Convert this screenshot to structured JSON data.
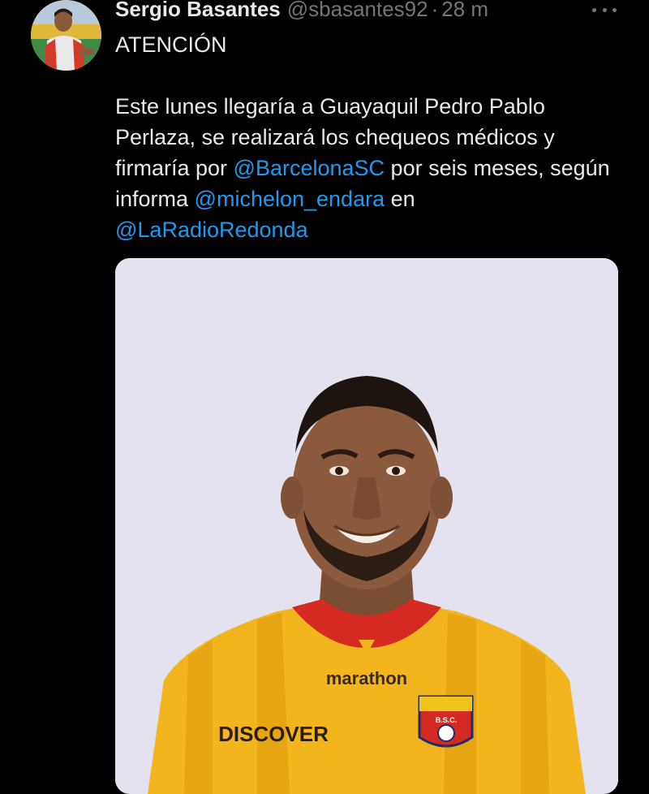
{
  "author": {
    "display_name": "Sergio Basantes",
    "handle": "@sbasantes92",
    "separator": "·",
    "time": "28 m"
  },
  "tweet": {
    "line1": "ATENCIÓN",
    "p2_a": "Este lunes llegaría a Guayaquil Pedro Pablo Perlaza, se realizará los chequeos médicos y firmaría por ",
    "mention_1": "@BarcelonaSC",
    "p2_b": " por seis meses, según informa ",
    "mention_2": "@michelon_endara",
    "p2_c": " en ",
    "mention_3": "@LaRadioRedonda"
  },
  "media": {
    "shirt_sponsor_top": "marathon",
    "shirt_sponsor_chest": "DISCOVER",
    "crest_text": "B.S.C."
  },
  "colors": {
    "background": "#000000",
    "text": "#e7e9ea",
    "muted": "#71767b",
    "link": "#1d9bf0",
    "shirt_yellow": "#f2b51d",
    "collar_red": "#d42a22",
    "photo_bg": "#e4e2ee"
  }
}
